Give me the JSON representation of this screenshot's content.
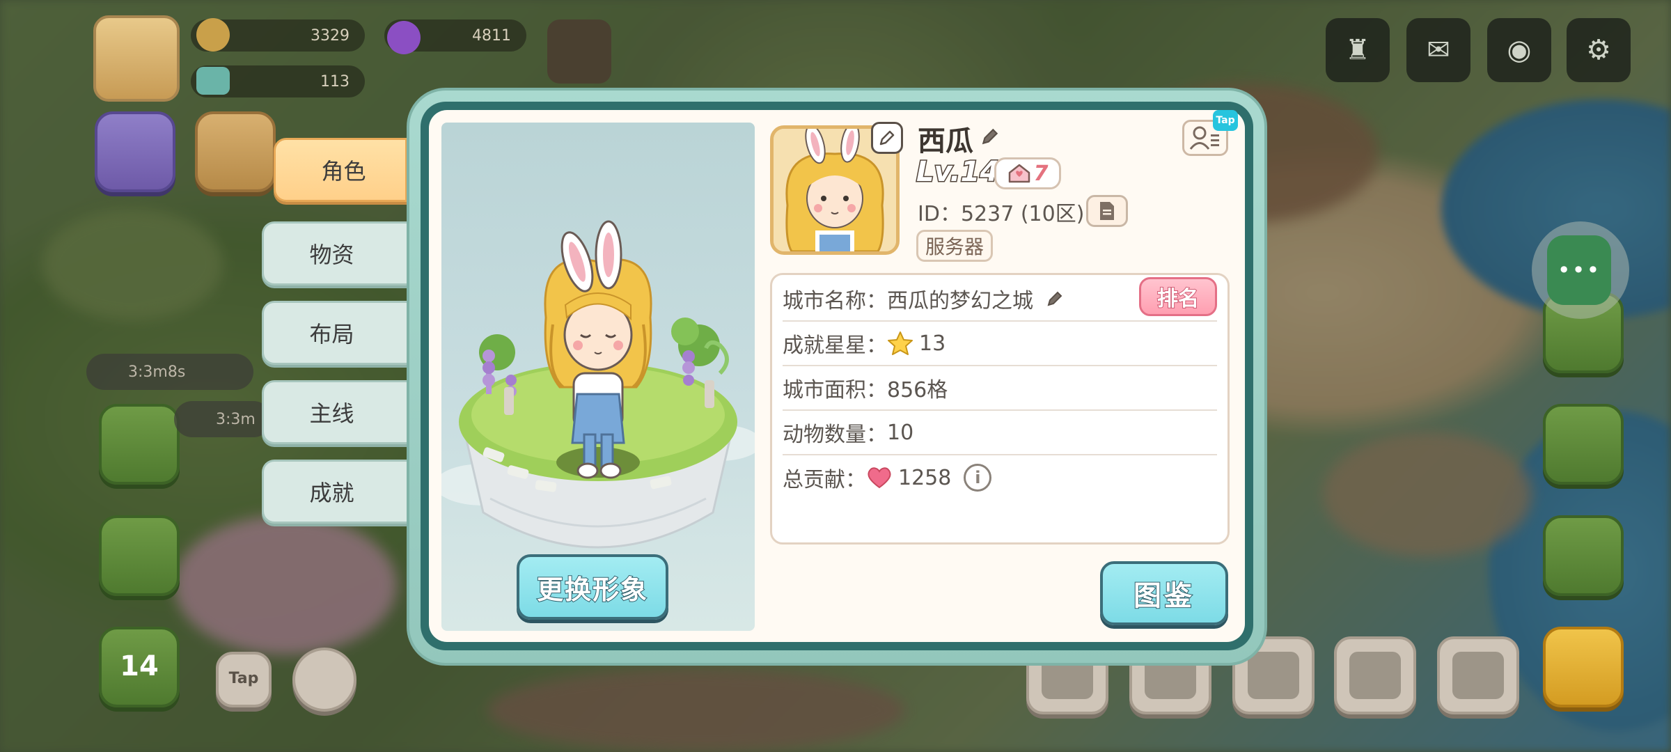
{
  "hud": {
    "coins": "3329",
    "gems": "4811",
    "energy": "113",
    "timer1": "3:3m8s",
    "timer2": "3:3m",
    "level_badge": "14",
    "tap_label": "Tap"
  },
  "tabs": [
    {
      "label": "角色",
      "active": true
    },
    {
      "label": "物资",
      "active": false
    },
    {
      "label": "布局",
      "active": false
    },
    {
      "label": "主线",
      "active": false
    },
    {
      "label": "成就",
      "active": false
    }
  ],
  "profile": {
    "name": "西瓜",
    "level": "Lv.14",
    "home_level": "7",
    "id_text": "ID：5237 (10区)",
    "server_label": "服务器",
    "friend_tap": "Tap",
    "change_look": "更换形象"
  },
  "info": {
    "city_name_label": "城市名称：",
    "city_name": "西瓜的梦幻之城",
    "rank_label": "排名",
    "stars_label": "成就星星：",
    "stars": "13",
    "area_label": "城市面积：",
    "area": "856格",
    "animals_label": "动物数量：",
    "animals": "10",
    "contrib_label": "总贡献：",
    "contrib": "1258",
    "info_icon": "i"
  },
  "atlas_label": "图鉴",
  "side_menu_label": "•••",
  "colors": {
    "accent_teal": "#7ddbe6",
    "tab_active": "#ffd08a",
    "rank_pink": "#ff9fb1",
    "panel_frame": "#2f6f6c"
  }
}
